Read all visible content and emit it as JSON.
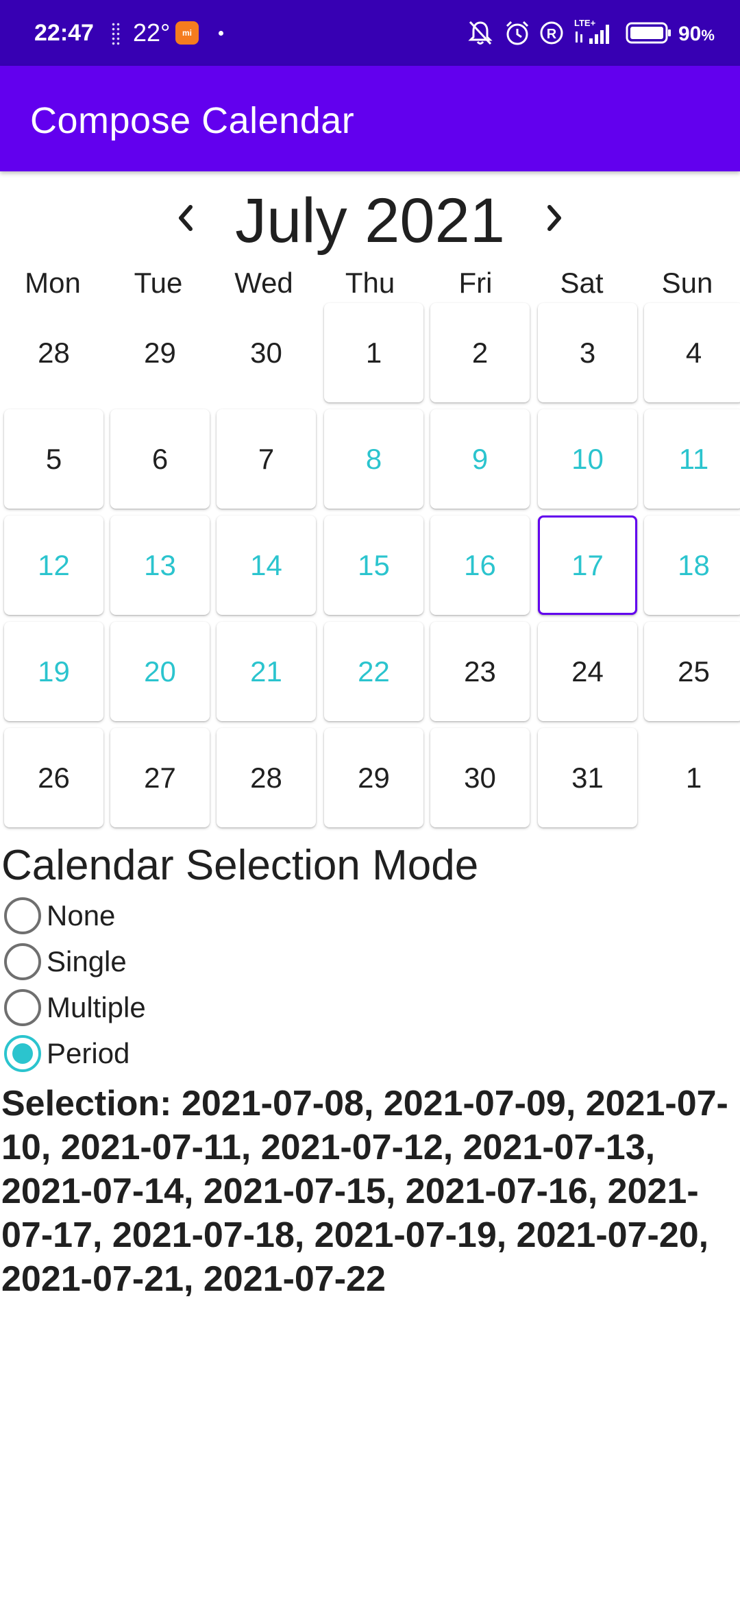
{
  "status_bar": {
    "time": "22:47",
    "temperature": "22°",
    "mi_badge": "mi",
    "network": "LTE+",
    "battery": "90",
    "battery_unit": "%",
    "icons": [
      "mute-icon",
      "alarm-icon",
      "registered-icon",
      "signal-icon",
      "battery-icon"
    ]
  },
  "app_bar": {
    "title": "Compose Calendar"
  },
  "calendar": {
    "month_title": "July 2021",
    "prev_icon": "chevron-left-icon",
    "next_icon": "chevron-right-icon",
    "weekdays": [
      "Mon",
      "Tue",
      "Wed",
      "Thu",
      "Fri",
      "Sat",
      "Sun"
    ],
    "weeks": [
      [
        {
          "d": "28",
          "inMonth": false
        },
        {
          "d": "29",
          "inMonth": false
        },
        {
          "d": "30",
          "inMonth": false
        },
        {
          "d": "1",
          "inMonth": true
        },
        {
          "d": "2",
          "inMonth": true
        },
        {
          "d": "3",
          "inMonth": true
        },
        {
          "d": "4",
          "inMonth": true
        }
      ],
      [
        {
          "d": "5",
          "inMonth": true
        },
        {
          "d": "6",
          "inMonth": true
        },
        {
          "d": "7",
          "inMonth": true
        },
        {
          "d": "8",
          "inMonth": true,
          "selected": true
        },
        {
          "d": "9",
          "inMonth": true,
          "selected": true
        },
        {
          "d": "10",
          "inMonth": true,
          "selected": true
        },
        {
          "d": "11",
          "inMonth": true,
          "selected": true
        }
      ],
      [
        {
          "d": "12",
          "inMonth": true,
          "selected": true
        },
        {
          "d": "13",
          "inMonth": true,
          "selected": true
        },
        {
          "d": "14",
          "inMonth": true,
          "selected": true
        },
        {
          "d": "15",
          "inMonth": true,
          "selected": true
        },
        {
          "d": "16",
          "inMonth": true,
          "selected": true
        },
        {
          "d": "17",
          "inMonth": true,
          "selected": true,
          "today": true
        },
        {
          "d": "18",
          "inMonth": true,
          "selected": true
        }
      ],
      [
        {
          "d": "19",
          "inMonth": true,
          "selected": true
        },
        {
          "d": "20",
          "inMonth": true,
          "selected": true
        },
        {
          "d": "21",
          "inMonth": true,
          "selected": true
        },
        {
          "d": "22",
          "inMonth": true,
          "selected": true
        },
        {
          "d": "23",
          "inMonth": true
        },
        {
          "d": "24",
          "inMonth": true
        },
        {
          "d": "25",
          "inMonth": true
        }
      ],
      [
        {
          "d": "26",
          "inMonth": true
        },
        {
          "d": "27",
          "inMonth": true
        },
        {
          "d": "28",
          "inMonth": true
        },
        {
          "d": "29",
          "inMonth": true
        },
        {
          "d": "30",
          "inMonth": true
        },
        {
          "d": "31",
          "inMonth": true
        },
        {
          "d": "1",
          "inMonth": false
        }
      ]
    ],
    "selected_color": "#2bc4ce",
    "today_border_color": "#6200ee"
  },
  "selection_mode": {
    "title": "Calendar Selection Mode",
    "options": [
      {
        "label": "None",
        "checked": false
      },
      {
        "label": "Single",
        "checked": false
      },
      {
        "label": "Multiple",
        "checked": false
      },
      {
        "label": "Period",
        "checked": true
      }
    ]
  },
  "selection": {
    "text": "Selection: 2021-07-08, 2021-07-09, 2021-07-10, 2021-07-11, 2021-07-12, 2021-07-13, 2021-07-14, 2021-07-15, 2021-07-16, 2021-07-17, 2021-07-18, 2021-07-19, 2021-07-20, 2021-07-21, 2021-07-22"
  },
  "colors": {
    "status_bar": "#3700b3",
    "app_bar": "#6200ee",
    "accent": "#2bc4ce"
  }
}
